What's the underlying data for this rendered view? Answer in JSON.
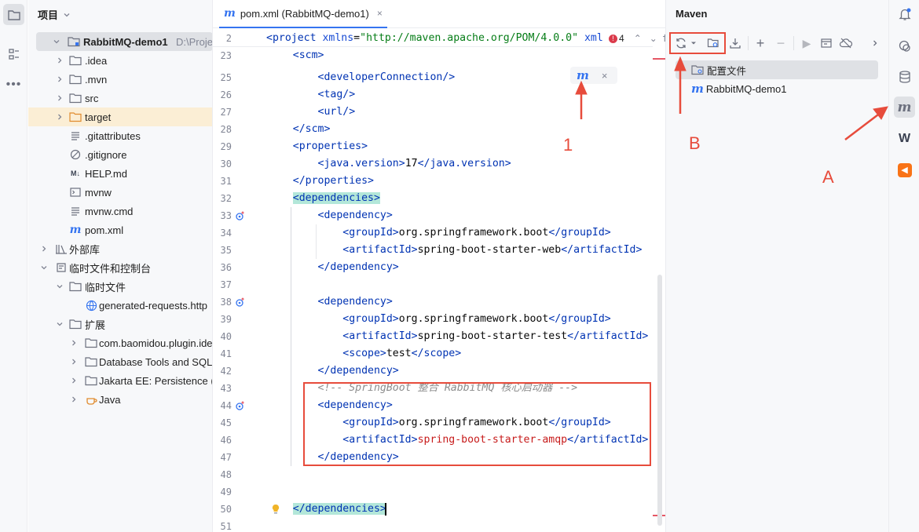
{
  "project_panel": {
    "title": "项目",
    "tree": [
      {
        "label": "RabbitMQ-demo1",
        "path": "D:\\Project\\t",
        "icon": "module-folder-icon",
        "expanded": true,
        "bold": true
      },
      {
        "label": ".idea",
        "icon": "folder-icon"
      },
      {
        "label": ".mvn",
        "icon": "folder-icon"
      },
      {
        "label": "src",
        "icon": "folder-icon"
      },
      {
        "label": "target",
        "icon": "folder-orange-icon"
      },
      {
        "label": ".gitattributes",
        "icon": "text-file-icon"
      },
      {
        "label": ".gitignore",
        "icon": "ignore-file-icon"
      },
      {
        "label": "HELP.md",
        "icon": "markdown-icon"
      },
      {
        "label": "mvnw",
        "icon": "shell-icon"
      },
      {
        "label": "mvnw.cmd",
        "icon": "text-file-icon"
      },
      {
        "label": "pom.xml",
        "icon": "maven-file-icon"
      },
      {
        "label": "外部库",
        "icon": "library-icon"
      },
      {
        "label": "临时文件和控制台",
        "icon": "scratch-icon"
      },
      {
        "label": "临时文件",
        "icon": "folder-icon"
      },
      {
        "label": "generated-requests.http",
        "icon": "http-icon"
      },
      {
        "label": "扩展",
        "icon": "folder-icon"
      },
      {
        "label": "com.baomidou.plugin.ide",
        "icon": "folder-icon"
      },
      {
        "label": "Database Tools and SQL",
        "icon": "folder-icon"
      },
      {
        "label": "Jakarta EE: Persistence (J",
        "icon": "folder-icon"
      },
      {
        "label": "Java",
        "icon": "java-icon"
      }
    ]
  },
  "editor": {
    "tab_label": "pom.xml (RabbitMQ-demo1)",
    "sticky_line": {
      "num": "2",
      "text": "<project xmlns=\"http://maven.apache.org/POM/4.0.0\" xml"
    },
    "error_count": "4",
    "lines": [
      {
        "num": "23",
        "text": "    <scm>"
      },
      {
        "num": "25",
        "text": "        <developerConnection/>"
      },
      {
        "num": "26",
        "text": "        <tag/>"
      },
      {
        "num": "27",
        "text": "        <url/>"
      },
      {
        "num": "28",
        "text": "    </scm>"
      },
      {
        "num": "29",
        "text": "    <properties>"
      },
      {
        "num": "30",
        "text": "        <java.version>17</java.version>"
      },
      {
        "num": "31",
        "text": "    </properties>"
      },
      {
        "num": "32",
        "text": "    <dependencies>"
      },
      {
        "num": "33",
        "text": "        <dependency>"
      },
      {
        "num": "34",
        "text": "            <groupId>org.springframework.boot</groupId>"
      },
      {
        "num": "35",
        "text": "            <artifactId>spring-boot-starter-web</artifactId>"
      },
      {
        "num": "36",
        "text": "        </dependency>"
      },
      {
        "num": "37",
        "text": ""
      },
      {
        "num": "38",
        "text": "        <dependency>"
      },
      {
        "num": "39",
        "text": "            <groupId>org.springframework.boot</groupId>"
      },
      {
        "num": "40",
        "text": "            <artifactId>spring-boot-starter-test</artifactId>"
      },
      {
        "num": "41",
        "text": "            <scope>test</scope>"
      },
      {
        "num": "42",
        "text": "        </dependency>"
      },
      {
        "num": "43",
        "text": "        <!-- SpringBoot 整合 RabbitMQ 核心启动器 -->"
      },
      {
        "num": "44",
        "text": "        <dependency>"
      },
      {
        "num": "45",
        "text": "            <groupId>org.springframework.boot</groupId>"
      },
      {
        "num": "46",
        "text": "            <artifactId>spring-boot-starter-amqp</artifactId>"
      },
      {
        "num": "47",
        "text": "        </dependency>"
      },
      {
        "num": "48",
        "text": ""
      },
      {
        "num": "49",
        "text": ""
      },
      {
        "num": "50",
        "text": "    </dependencies>"
      },
      {
        "num": "51",
        "text": ""
      }
    ]
  },
  "maven_panel": {
    "title": "Maven",
    "items": [
      {
        "label": "配置文件",
        "icon": "profiles-icon"
      },
      {
        "label": "RabbitMQ-demo1",
        "icon": "maven-icon"
      }
    ]
  },
  "annotations": {
    "label_1": "1",
    "label_a": "A",
    "label_b": "B",
    "color": "#e74c3c"
  }
}
